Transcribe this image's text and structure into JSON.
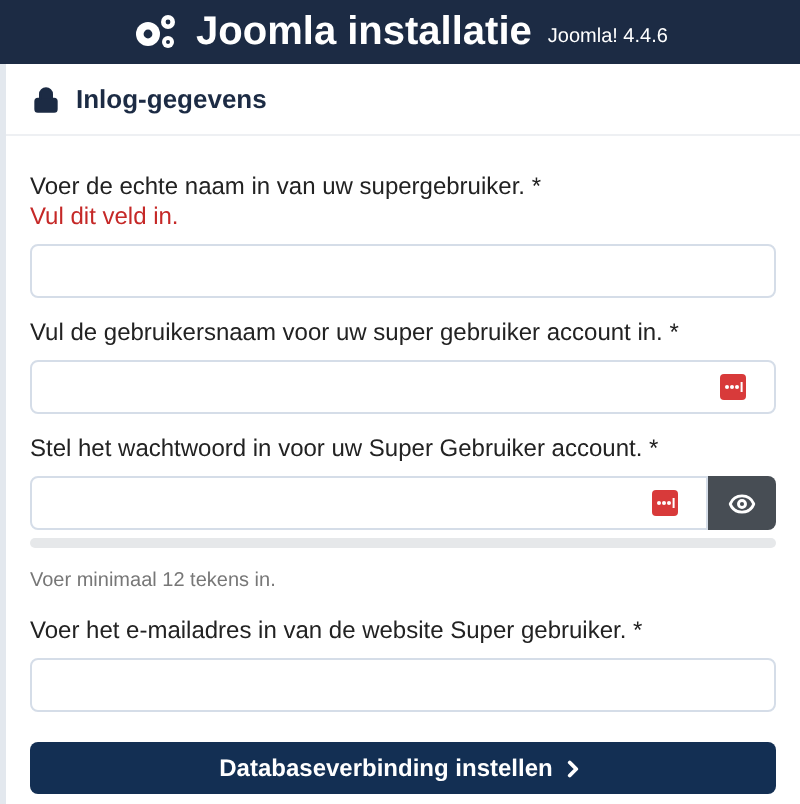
{
  "header": {
    "title": "Joomla installatie",
    "version": "Joomla! 4.4.6"
  },
  "section": {
    "title": "Inlog-gegevens"
  },
  "fields": [
    {
      "kind": "text",
      "label": "Voer de echte naam in van uw supergebruiker. *",
      "error": "Vul dit veld in.",
      "manager_icon": false
    },
    {
      "kind": "text",
      "label": "Vul de gebruikersnaam voor uw super gebruiker account in. *",
      "manager_icon": true
    },
    {
      "kind": "password",
      "label": "Stel het wachtwoord in voor uw Super Gebruiker account. *",
      "manager_icon": true,
      "strength": {
        "level": 0
      },
      "hint": "Voer minimaal 12 tekens in."
    },
    {
      "kind": "text",
      "label": "Voer het e-mailadres in van de website Super gebruiker. *",
      "manager_icon": false
    }
  ],
  "submit": {
    "label": "Databaseverbinding instellen"
  }
}
